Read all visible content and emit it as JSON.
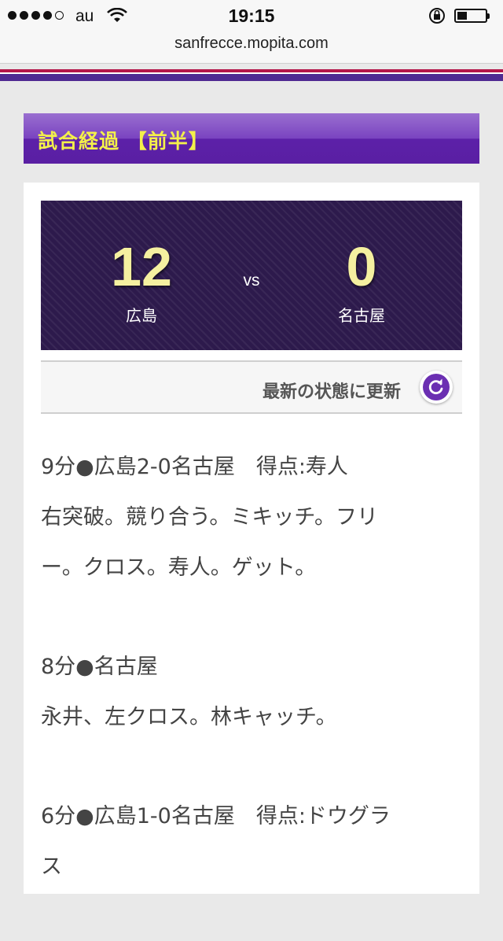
{
  "status_bar": {
    "carrier": "au",
    "time": "19:15",
    "signal_bars_filled": 4,
    "signal_bars_total": 5,
    "battery_level": 0.35
  },
  "browser": {
    "url": "sanfrecce.mopita.com"
  },
  "colors": {
    "accent_purple": "#5a1fa3",
    "header_text_yellow": "#f3f04a",
    "scoreboard_bg": "#2d1a4c",
    "stripe_red": "#b5164a"
  },
  "section": {
    "title": "試合経過 【前半】"
  },
  "scoreboard": {
    "home_score": "12",
    "vs": "vs",
    "away_score": "0",
    "home_team": "広島",
    "away_team": "名古屋"
  },
  "refresh": {
    "label": "最新の状態に更新",
    "icon": "refresh-icon"
  },
  "feed": [
    {
      "lines": [
        "9分●広島2-0名古屋　得点:寿人",
        "右突破。競り合う。ミキッチ。フリ",
        "ー。クロス。寿人。ゲット。"
      ]
    },
    {
      "lines": [
        "8分●名古屋",
        "永井、左クロス。林キャッチ。"
      ]
    },
    {
      "lines": [
        "6分●広島1-0名古屋　得点:ドウグラ",
        "ス"
      ]
    }
  ]
}
